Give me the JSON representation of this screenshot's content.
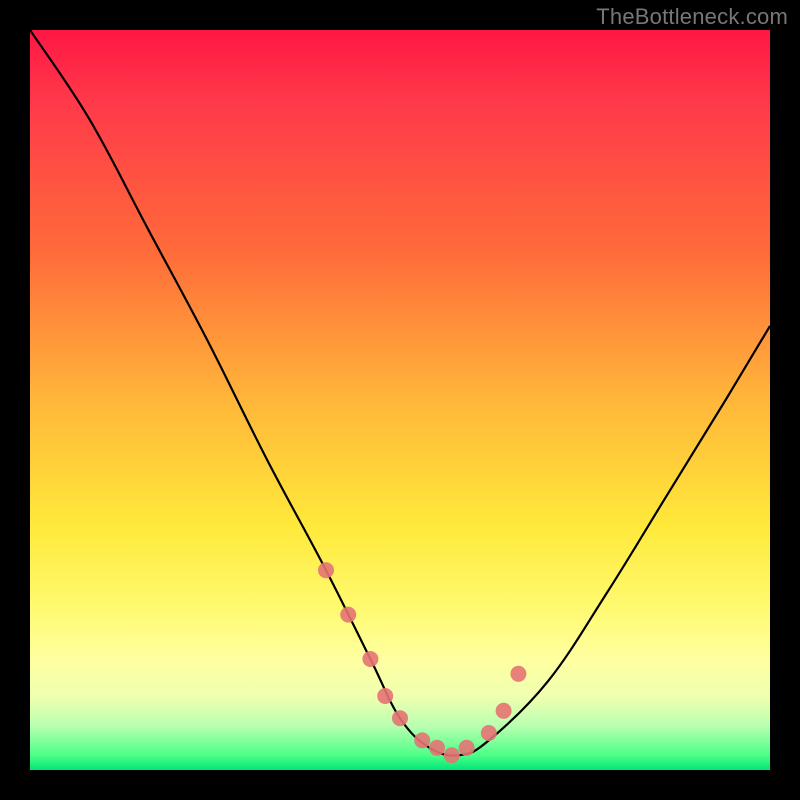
{
  "watermark": "TheBottleneck.com",
  "chart_data": {
    "type": "line",
    "title": "",
    "xlabel": "",
    "ylabel": "",
    "xlim": [
      0,
      100
    ],
    "ylim": [
      0,
      100
    ],
    "series": [
      {
        "name": "curve",
        "x": [
          0,
          8,
          16,
          24,
          32,
          40,
          46,
          50,
          54,
          58,
          62,
          70,
          78,
          86,
          94,
          100
        ],
        "values": [
          100,
          88,
          73,
          58,
          42,
          27,
          15,
          7,
          3,
          2,
          4,
          12,
          24,
          37,
          50,
          60
        ]
      }
    ],
    "markers": {
      "name": "highlighted-points",
      "color": "#e57373",
      "x": [
        40,
        43,
        46,
        48,
        50,
        53,
        55,
        57,
        59,
        62,
        64,
        66
      ],
      "values": [
        27,
        21,
        15,
        10,
        7,
        4,
        3,
        2,
        3,
        5,
        8,
        13
      ]
    },
    "background_gradient": {
      "top": "#ff1744",
      "mid_orange": "#ffb63a",
      "mid_yellow": "#ffe93a",
      "bottom": "#00e676"
    }
  }
}
